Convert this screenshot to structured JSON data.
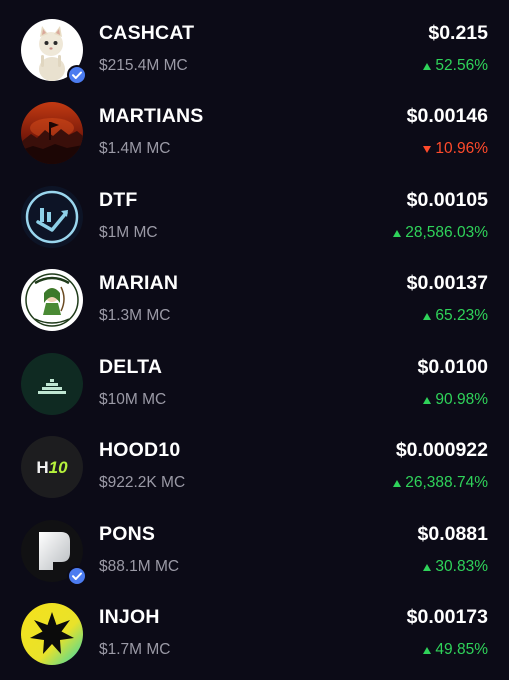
{
  "tokens": [
    {
      "name": "CASHCAT",
      "market_cap": "$215.4M MC",
      "price": "$0.215",
      "change": "52.56%",
      "direction": "up",
      "verified": true,
      "icon": "cat-avatar-icon"
    },
    {
      "name": "MARTIANS",
      "market_cap": "$1.4M MC",
      "price": "$0.00146",
      "change": "10.96%",
      "direction": "down",
      "verified": false,
      "icon": "martian-landscape-icon"
    },
    {
      "name": "DTF",
      "market_cap": "$1M MC",
      "price": "$0.00105",
      "change": "28,586.03%",
      "direction": "up",
      "verified": false,
      "icon": "dtf-logo-icon"
    },
    {
      "name": "MARIAN",
      "market_cap": "$1.3M MC",
      "price": "$0.00137",
      "change": "65.23%",
      "direction": "up",
      "verified": false,
      "icon": "marian-character-icon"
    },
    {
      "name": "DELTA",
      "market_cap": "$10M MC",
      "price": "$0.0100",
      "change": "90.98%",
      "direction": "up",
      "verified": false,
      "icon": "delta-pyramid-icon"
    },
    {
      "name": "HOOD10",
      "market_cap": "$922.2K MC",
      "price": "$0.000922",
      "change": "26,388.74%",
      "direction": "up",
      "verified": false,
      "icon": "h10-logo-icon",
      "icon_text": "H10"
    },
    {
      "name": "PONS",
      "market_cap": "$88.1M MC",
      "price": "$0.0881",
      "change": "30.83%",
      "direction": "up",
      "verified": true,
      "icon": "pons-logo-icon"
    },
    {
      "name": "INJOH",
      "market_cap": "$1.7M MC",
      "price": "$0.00173",
      "change": "49.85%",
      "direction": "up",
      "verified": false,
      "icon": "injoh-star-icon"
    }
  ],
  "colors": {
    "background": "#0c0b17",
    "positive": "#2fd35a",
    "negative": "#ff4a2b",
    "muted_text": "#9b9aa6",
    "verified_badge": "#4c7cf0"
  }
}
